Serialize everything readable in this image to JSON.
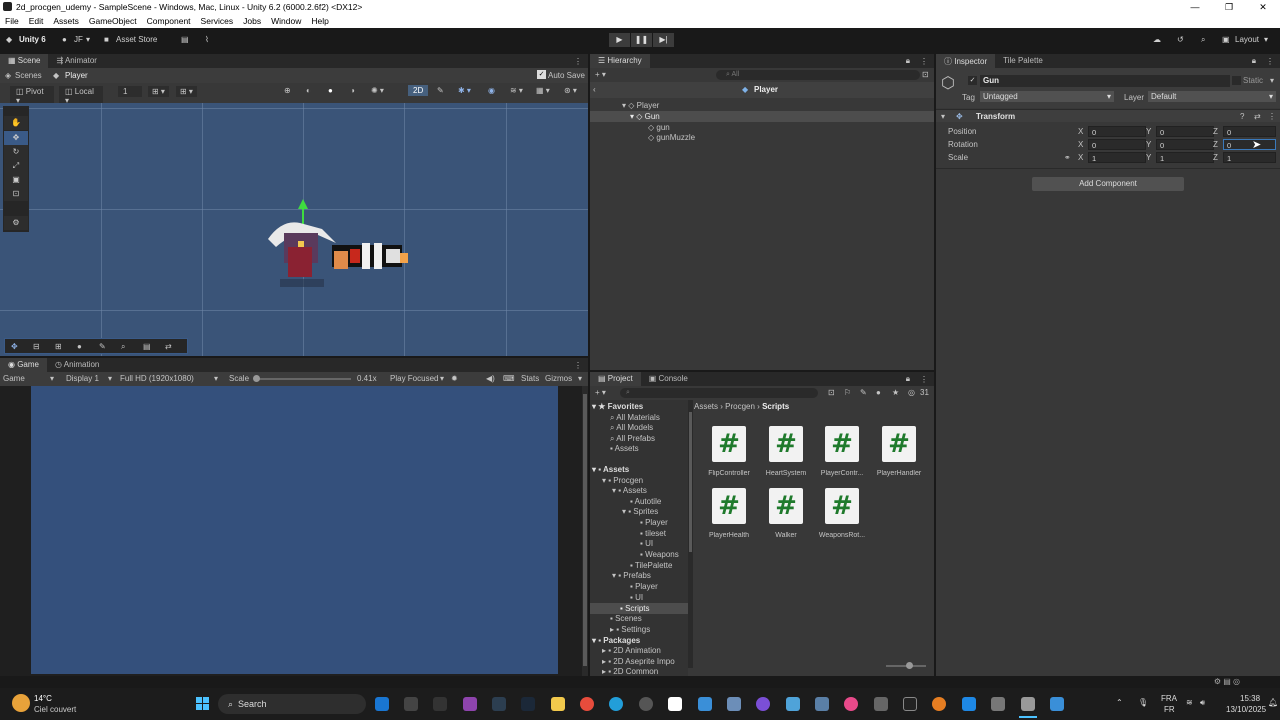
{
  "window": {
    "title": "2d_procgen_udemy - SampleScene - Windows, Mac, Linux - Unity 6.2 (6000.2.6f2) <DX12>",
    "controls": [
      "—",
      "❐",
      "✕"
    ]
  },
  "menu": [
    "File",
    "Edit",
    "Assets",
    "GameObject",
    "Component",
    "Services",
    "Jobs",
    "Window",
    "Help"
  ],
  "toolbar": {
    "unity_label": "Unity 6",
    "account": "JF",
    "asset_store": "Asset Store",
    "layout": "Layout"
  },
  "scene_panel": {
    "tabs": [
      "Scene",
      "Animator"
    ],
    "breadcrumb_root": "Scenes",
    "breadcrumb_item": "Player",
    "auto_save": "Auto Save",
    "pivot": "Pivot",
    "local": "Local",
    "grid_value": "1",
    "mode_2d": "2D"
  },
  "game_panel": {
    "tabs": [
      "Game",
      "Animation"
    ],
    "game_dropdown": "Game",
    "display": "Display 1",
    "resolution": "Full HD (1920x1080)",
    "scale_label": "Scale",
    "scale_value": "0.41x",
    "play_focused": "Play Focused",
    "stats": "Stats",
    "gizmos": "Gizmos"
  },
  "hierarchy": {
    "tab": "Hierarchy",
    "search_placeholder": "All",
    "scene_name": "Player",
    "items": [
      {
        "label": "Player",
        "indent": 0
      },
      {
        "label": "Gun",
        "indent": 1
      },
      {
        "label": "gun",
        "indent": 2
      },
      {
        "label": "gunMuzzle",
        "indent": 2
      }
    ]
  },
  "inspector": {
    "tabs": [
      "Inspector",
      "Tile Palette"
    ],
    "object_name": "Gun",
    "static_label": "Static",
    "tag_label": "Tag",
    "tag_value": "Untagged",
    "layer_label": "Layer",
    "layer_value": "Default",
    "component": "Transform",
    "rows": [
      {
        "label": "Position",
        "x": "0",
        "y": "0",
        "z": "0"
      },
      {
        "label": "Rotation",
        "x": "0",
        "y": "0",
        "z": "0"
      },
      {
        "label": "Scale",
        "x": "1",
        "y": "1",
        "z": "1"
      }
    ],
    "axis_x": "X",
    "axis_y": "Y",
    "axis_z": "Z",
    "add_component": "Add Component"
  },
  "project": {
    "tabs": [
      "Project",
      "Console"
    ],
    "count": "31",
    "breadcrumb": [
      "Assets",
      "Procgen",
      "Scripts"
    ],
    "tree": [
      {
        "label": "Favorites",
        "bold": true
      },
      {
        "label": "All Materials"
      },
      {
        "label": "All Models"
      },
      {
        "label": "All Prefabs"
      },
      {
        "label": "Assets"
      },
      {
        "label": "Assets",
        "bold": true
      },
      {
        "label": "Procgen"
      },
      {
        "label": "Assets"
      },
      {
        "label": "Autotile"
      },
      {
        "label": "Sprites"
      },
      {
        "label": "Player"
      },
      {
        "label": "tileset"
      },
      {
        "label": "UI"
      },
      {
        "label": "Weapons"
      },
      {
        "label": "TilePalette"
      },
      {
        "label": "Prefabs"
      },
      {
        "label": "Player"
      },
      {
        "label": "UI"
      },
      {
        "label": "Scripts"
      },
      {
        "label": "Scenes"
      },
      {
        "label": "Settings"
      },
      {
        "label": "Packages",
        "bold": true
      },
      {
        "label": "2D Animation"
      },
      {
        "label": "2D Aseprite Impo"
      },
      {
        "label": "2D Common"
      }
    ],
    "assets": [
      "FlipController",
      "HeartSystem",
      "PlayerContr...",
      "PlayerHandler",
      "PlayerHealth",
      "Walker",
      "WeaponsRot..."
    ],
    "asset_glyph": "#"
  },
  "taskbar": {
    "temperature": "14°C",
    "weather": "Ciel couvert",
    "search": "Search",
    "lang_top": "FRA",
    "lang_bottom": "FR",
    "time": "15:38",
    "date": "13/10/2025"
  }
}
